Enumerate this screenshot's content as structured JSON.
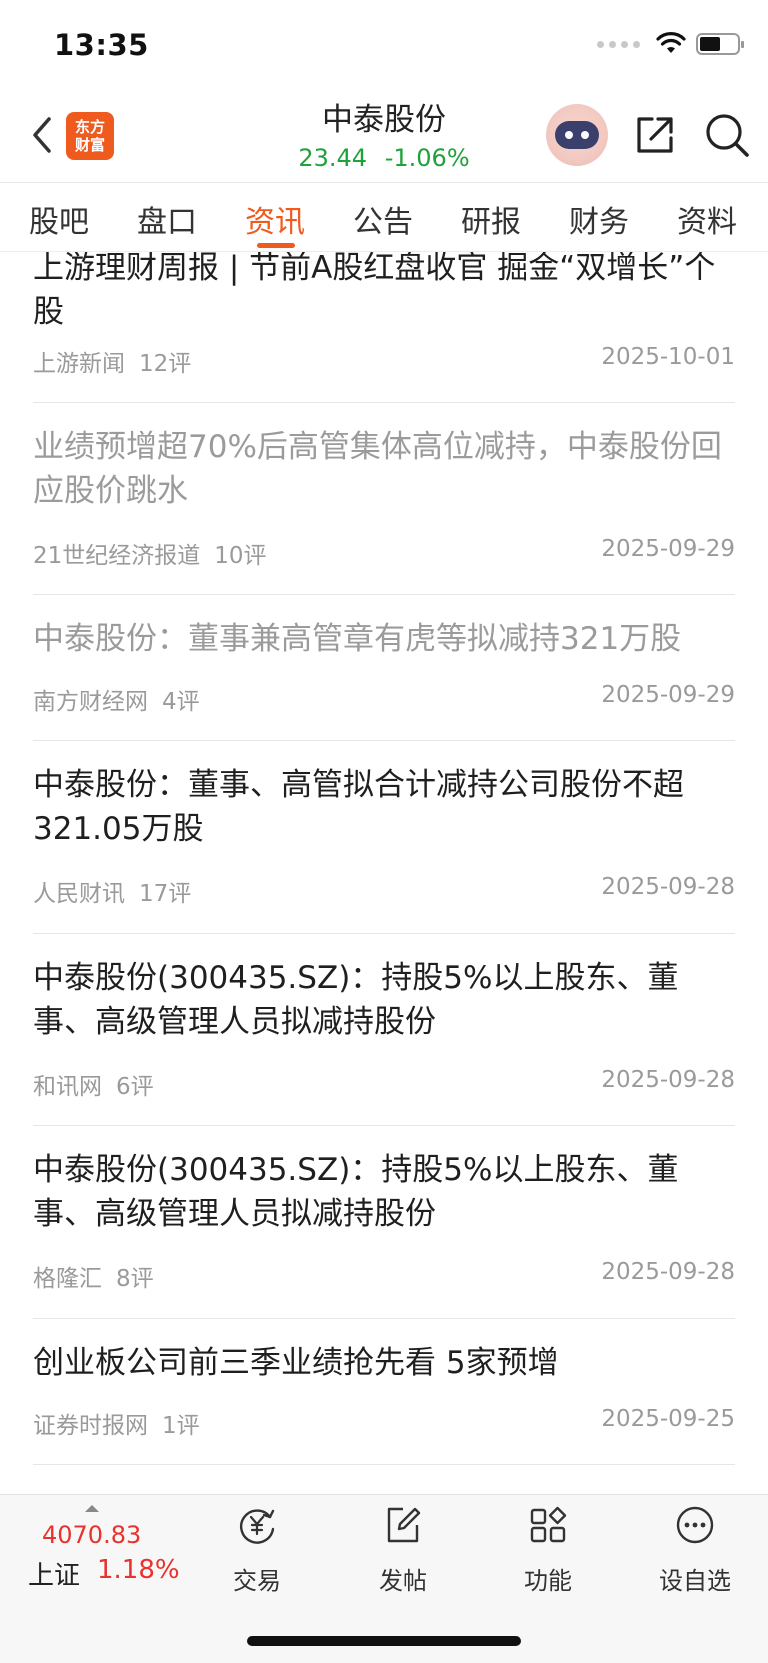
{
  "status_bar": {
    "time": "13:35"
  },
  "header": {
    "logo_line1": "东方",
    "logo_line2": "财富",
    "stock_name": "中泰股份",
    "price": "23.44",
    "change": "-1.06%",
    "quote_color": "#1fa23a"
  },
  "tabs": [
    {
      "label": "股吧"
    },
    {
      "label": "盘口"
    },
    {
      "label": "资讯",
      "active": true
    },
    {
      "label": "公告"
    },
    {
      "label": "研报"
    },
    {
      "label": "财务"
    },
    {
      "label": "资料"
    }
  ],
  "news": [
    {
      "title": "上游理财周报 | 节前A股红盘收官 掘金“双增长”个股",
      "source": "上游新闻",
      "comments": "12评",
      "date": "2025-10-01",
      "read": false
    },
    {
      "title": "业绩预增超70%后高管集体高位减持，中泰股份回应股价跳水",
      "source": "21世纪经济报道",
      "comments": "10评",
      "date": "2025-09-29",
      "read": true
    },
    {
      "title": "中泰股份：董事兼高管章有虎等拟减持321万股",
      "source": "南方财经网",
      "comments": "4评",
      "date": "2025-09-29",
      "read": true
    },
    {
      "title": "中泰股份：董事、高管拟合计减持公司股份不超321.05万股",
      "source": "人民财讯",
      "comments": "17评",
      "date": "2025-09-28",
      "read": false
    },
    {
      "title": "中泰股份(300435.SZ)：持股5%以上股东、董事、高级管理人员拟减持股份",
      "source": "和讯网",
      "comments": "6评",
      "date": "2025-09-28",
      "read": false
    },
    {
      "title": "中泰股份(300435.SZ)：持股5%以上股东、董事、高级管理人员拟减持股份",
      "source": "格隆汇",
      "comments": "8评",
      "date": "2025-09-28",
      "read": false
    },
    {
      "title": "创业板公司前三季业绩抢先看 5家预增",
      "source": "证券时报网",
      "comments": "1评",
      "date": "2025-09-25",
      "read": false
    }
  ],
  "bottom_bar": {
    "index_value": "4070.83",
    "index_name": "上证",
    "index_change": "1.18%",
    "items": [
      {
        "label": "交易",
        "icon": "yuan-exchange-icon"
      },
      {
        "label": "发帖",
        "icon": "edit-post-icon"
      },
      {
        "label": "功能",
        "icon": "grid-apps-icon"
      },
      {
        "label": "设自选",
        "icon": "more-circle-icon"
      }
    ]
  },
  "colors": {
    "accent": "#ef5a1e",
    "up": "#e8322d",
    "down": "#1fa23a"
  }
}
